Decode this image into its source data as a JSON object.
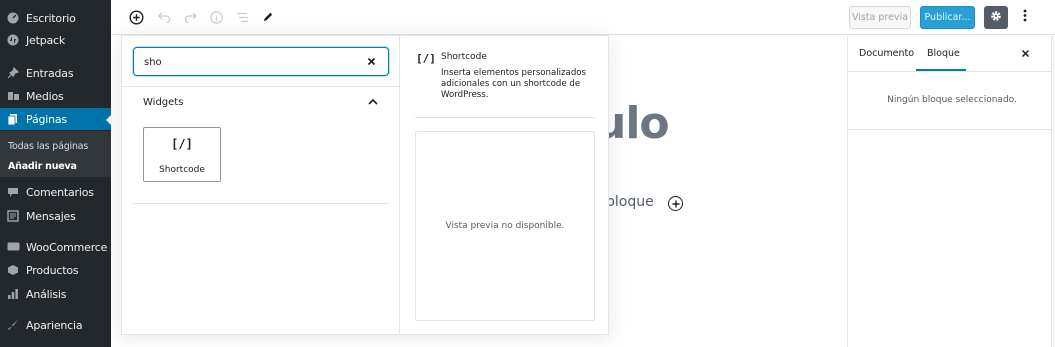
{
  "admin_menu": {
    "items": [
      {
        "label": "Escritorio",
        "icon": "dashboard-icon"
      },
      {
        "label": "Jetpack",
        "icon": "jetpack-icon"
      },
      {
        "label": "Entradas",
        "icon": "pin-icon"
      },
      {
        "label": "Medios",
        "icon": "media-icon"
      },
      {
        "label": "Páginas",
        "icon": "pages-icon"
      },
      {
        "label": "Comentarios",
        "icon": "comments-icon"
      },
      {
        "label": "Mensajes",
        "icon": "messages-icon"
      },
      {
        "label": "WooCommerce",
        "icon": "woocommerce-icon"
      },
      {
        "label": "Productos",
        "icon": "products-icon"
      },
      {
        "label": "Análisis",
        "icon": "analytics-icon"
      },
      {
        "label": "Apariencia",
        "icon": "appearance-icon"
      }
    ],
    "active_index": 4,
    "submenu": [
      {
        "label": "Todas las páginas"
      },
      {
        "label": "Añadir nueva"
      }
    ],
    "current_submenu_index": 1,
    "bg_color": "#23282d",
    "active_color": "#0073aa"
  },
  "toolbar": {
    "icons": [
      "add-block-icon",
      "undo-icon",
      "redo-icon",
      "info-icon",
      "outline-icon",
      "edit-tools-icon"
    ],
    "preview_label": "Vista previa",
    "publish_label": "Publicar...",
    "settings_icon": "gear-icon",
    "more_icon": "more-vertical-icon",
    "publish_color": "#2a9fd6"
  },
  "canvas": {
    "title_fragment": "ulo",
    "paragraph_fragment": "bloque"
  },
  "inserter": {
    "search": {
      "value": "sho",
      "placeholder": ""
    },
    "panel_title": "Widgets",
    "blocks": [
      {
        "icon": "[/]",
        "label": "Shortcode"
      }
    ],
    "preview": {
      "icon": "[/]",
      "title": "Shortcode",
      "description": "Inserta elementos personalizados adicionales con un shortcode de WordPress.",
      "empty_text": "Vista previa no disponible."
    }
  },
  "settings_sidebar": {
    "tabs": [
      {
        "label": "Documento"
      },
      {
        "label": "Bloque"
      }
    ],
    "active_tab_index": 1,
    "empty_text": "Ningún bloque seleccionado."
  }
}
